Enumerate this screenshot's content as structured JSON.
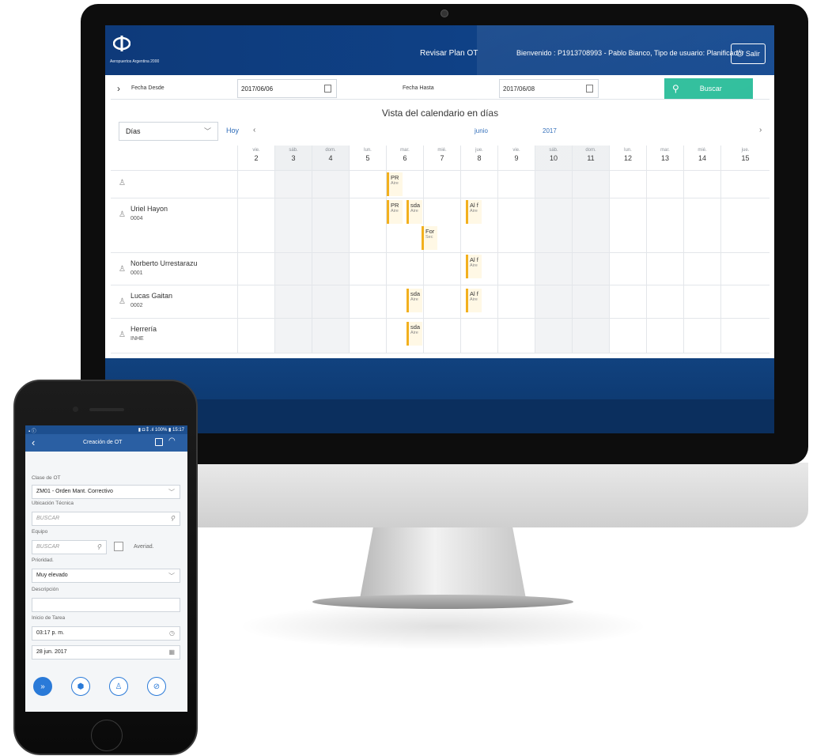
{
  "desktop": {
    "logo_text": "Aeropuertos Argentina 2000",
    "header_title": "Revisar Plan OT",
    "welcome": "Bienvenido : P1913708993 - Pablo Bianco, Tipo de usuario: Planificador",
    "exit_label": "Salir",
    "filters": {
      "from_label": "Fecha Desde",
      "from_value": "2017/06/06",
      "to_label": "Fecha Hasta",
      "to_value": "2017/06/08",
      "search_label": "Buscar"
    },
    "calendar": {
      "title": "Vista del calendario en días",
      "view_select": "Días",
      "today_label": "Hoy",
      "month": "junio",
      "year": "2017",
      "days": [
        {
          "name": "vie.",
          "num": "2"
        },
        {
          "name": "sáb.",
          "num": "3"
        },
        {
          "name": "dom.",
          "num": "4"
        },
        {
          "name": "lun.",
          "num": "5"
        },
        {
          "name": "mar.",
          "num": "6"
        },
        {
          "name": "mié.",
          "num": "7"
        },
        {
          "name": "jue.",
          "num": "8"
        },
        {
          "name": "vie.",
          "num": "9"
        },
        {
          "name": "sáb.",
          "num": "10"
        },
        {
          "name": "dom.",
          "num": "11"
        },
        {
          "name": "lun.",
          "num": "12"
        },
        {
          "name": "mar.",
          "num": "13"
        },
        {
          "name": "mié.",
          "num": "14"
        },
        {
          "name": "jue.",
          "num": "15"
        }
      ],
      "resources": [
        {
          "name": "",
          "code": ""
        },
        {
          "name": "Uriel Hayon",
          "code": "0004"
        },
        {
          "name": "Norberto Urrestarazu",
          "code": "0001"
        },
        {
          "name": "Lucas Gaitan",
          "code": "0002"
        },
        {
          "name": "Herrería",
          "code": "INHE"
        }
      ],
      "events": [
        {
          "title": "PR",
          "sub": "Aire"
        },
        {
          "title": "PR",
          "sub": "Aire"
        },
        {
          "title": "sda",
          "sub": "Aire"
        },
        {
          "title": "Al f",
          "sub": "Aire"
        },
        {
          "title": "For",
          "sub": "Sec"
        },
        {
          "title": "Al f",
          "sub": "Aire"
        },
        {
          "title": "sda",
          "sub": "Aire"
        },
        {
          "title": "Al f",
          "sub": "Aire"
        },
        {
          "title": "sda",
          "sub": "Aire"
        }
      ]
    }
  },
  "phone": {
    "status_left": "▪ ⓘ",
    "status_right": "▮ ◘ ⁑ .ıl 100% ▮ 15:17",
    "title": "Creación de OT",
    "fields": {
      "clase_label": "Clase de OT",
      "clase_value": "ZM01 - Orden Mant. Correctivo",
      "ubicacion_label": "Ubicación Técnica",
      "ubicacion_placeholder": "BUSCAR",
      "equipo_label": "Equipo",
      "equipo_placeholder": "BUSCAR",
      "averiad_label": "Averiad.",
      "prioridad_label": "Prioridad.",
      "prioridad_value": "Muy elevado",
      "descripcion_label": "Descripción",
      "inicio_label": "Inicio de Tarea",
      "hora_value": "03:17 p. m.",
      "fecha_value": "28 jun. 2017"
    }
  }
}
